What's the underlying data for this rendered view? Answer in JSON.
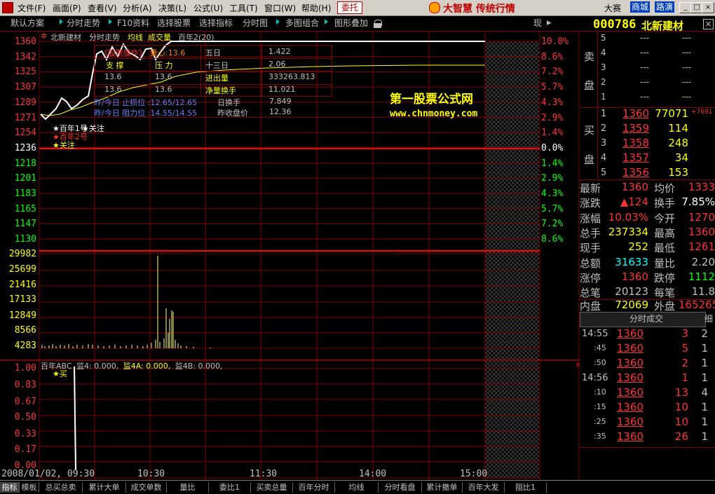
{
  "menu": {
    "items": [
      "文件(F)",
      "画面(P)",
      "查看(V)",
      "分析(A)",
      "决策(L)",
      "公式(U)",
      "工具(T)",
      "窗口(W)",
      "帮助(H)"
    ],
    "weituo": "委托",
    "brand": "大智慧 传统行情",
    "right_buttons": [
      "大赛",
      "商城",
      "路演"
    ],
    "win_btns": [
      "_",
      "□",
      "×"
    ]
  },
  "toolbar": {
    "items": [
      "默认方案",
      "分时走势",
      "F10资料",
      "选择股票",
      "选择指标",
      "分时图",
      "多图组合",
      "图形叠加"
    ],
    "right_label": "现"
  },
  "chart": {
    "header": {
      "stock": "北新建材",
      "mode": "分时走势",
      "avg": "均线",
      "vol": "成交量",
      "ind": "百年2(20)"
    },
    "price_labels": [
      "1360",
      "1342",
      "1325",
      "1307",
      "1289",
      "1271",
      "1254",
      "1236",
      "1218",
      "1201",
      "1183",
      "1165",
      "1147",
      "1130"
    ],
    "pct_labels": [
      "10.0%",
      "8.6%",
      "7.2%",
      "5.7%",
      "4.3%",
      "2.9%",
      "1.4%",
      "0.0%",
      "1.4%",
      "2.9%",
      "4.3%",
      "5.7%",
      "7.2%",
      "8.6%"
    ],
    "volume_labels": [
      "29982",
      "25699",
      "21416",
      "17133",
      "12849",
      "8566",
      "4283"
    ],
    "ind_labels": [
      "1.00",
      "0.83",
      "0.67",
      "0.50",
      "0.33",
      "0.17",
      "0.00"
    ],
    "ind_header": "百年ABC  监4: 0.000, 监4A: 0.000, 监4B: 0.000,",
    "ind_header_parts": {
      "a": "百年ABC",
      "b": "监4: 0.000,",
      "c": "监4A: 0.000,",
      "d": "监4B: 0.000,"
    },
    "buy_mark": "★买",
    "time_labels": [
      "2008/01/02, 09:30",
      "10:30",
      "11:30",
      "14:00",
      "15:00"
    ],
    "watermark_title": "第一股票公式网",
    "watermark_url": "www.chnmoney.com",
    "signals": [
      "★百年1号",
      "★关注",
      "★百年2号",
      "★关注"
    ],
    "info_box": {
      "row1": [
        "《股票操作》",
        "重心:13.6",
        "五日",
        "1.422"
      ],
      "row2": [
        "支 撑",
        "压 力",
        "十三日",
        "2.06"
      ],
      "row3": [
        "13.6",
        "13.6",
        "进出量",
        "333263.813"
      ],
      "row4": [
        "13.6",
        "13.6",
        "净量换手",
        "11.021"
      ],
      "row5": [
        "昨/今日 止损位 :12.65/12.65",
        "日换手",
        "7.849"
      ],
      "row6": [
        "昨/今日 阻力位 :14.55/14.55",
        "昨收盘价",
        "12.36"
      ]
    }
  },
  "quote": {
    "code": "000786",
    "name": "北新建材",
    "sell_label": [
      "卖",
      "盘"
    ],
    "buy_label": [
      "买",
      "盘"
    ],
    "sell": [
      {
        "n": "5",
        "p": "---",
        "v": "---"
      },
      {
        "n": "4",
        "p": "---",
        "v": "---"
      },
      {
        "n": "3",
        "p": "---",
        "v": "---"
      },
      {
        "n": "2",
        "p": "---",
        "v": "---"
      },
      {
        "n": "1",
        "p": "---",
        "v": "---"
      }
    ],
    "buy": [
      {
        "n": "1",
        "p": "1360",
        "v": "77071",
        "x": "+7691"
      },
      {
        "n": "2",
        "p": "1359",
        "v": "114",
        "x": ""
      },
      {
        "n": "3",
        "p": "1358",
        "v": "248",
        "x": ""
      },
      {
        "n": "4",
        "p": "1357",
        "v": "34",
        "x": ""
      },
      {
        "n": "5",
        "p": "1356",
        "v": "153",
        "x": ""
      }
    ],
    "stats": [
      {
        "l1": "最新",
        "v1": "1360",
        "l2": "均价",
        "v2": "1333"
      },
      {
        "l1": "涨跌",
        "v1": "▲124",
        "l2": "换手",
        "v2": "7.85%"
      },
      {
        "l1": "涨幅",
        "v1": "10.03%",
        "l2": "今开",
        "v2": "1270"
      },
      {
        "l1": "总手",
        "v1": "237334",
        "l2": "最高",
        "v2": "1360"
      },
      {
        "l1": "现手",
        "v1": "252",
        "l2": "最低",
        "v2": "1261"
      },
      {
        "l1": "总额",
        "v1": "31633",
        "l2": "量比",
        "v2": "2.20"
      },
      {
        "l1": "涨停",
        "v1": "1360",
        "l2": "跌停",
        "v2": "1112"
      },
      {
        "l1": "总笔",
        "v1": "20123",
        "l2": "每笔",
        "v2": "11.8"
      }
    ],
    "inner": {
      "l1": "内盘",
      "v1": "72069",
      "l2": "外盘",
      "v2": "165265"
    },
    "ticks_header": "分时成交",
    "ticks_tab": "细",
    "ticks": [
      {
        "t": "14:55",
        "p": "1360",
        "v": "3",
        "n": "2"
      },
      {
        "t": ":45",
        "p": "1360",
        "v": "5",
        "n": "1"
      },
      {
        "t": ":50",
        "p": "1360",
        "v": "2",
        "n": "1"
      },
      {
        "t": "14:56",
        "p": "1360",
        "v": "1",
        "n": "1"
      },
      {
        "t": ":10",
        "p": "1360",
        "v": "13",
        "n": "4"
      },
      {
        "t": ":15",
        "p": "1360",
        "v": "10",
        "n": "1"
      },
      {
        "t": ":25",
        "p": "1360",
        "v": "10",
        "n": "1"
      },
      {
        "t": ":35",
        "p": "1360",
        "v": "26",
        "n": "1"
      }
    ]
  },
  "bottom_tabs": [
    "指标",
    "模板",
    "总买总卖",
    "累计大单",
    "成交单数",
    "量比",
    "委比1",
    "买卖总量",
    "百年分时",
    "均线",
    "分时看盘",
    "累计撤单",
    "百年大发",
    "阻比1"
  ],
  "colors": {
    "up": "#ff3232",
    "down": "#00ff00",
    "grid": "#800000",
    "yellow": "#ffff00",
    "cyan": "#00ffff"
  }
}
